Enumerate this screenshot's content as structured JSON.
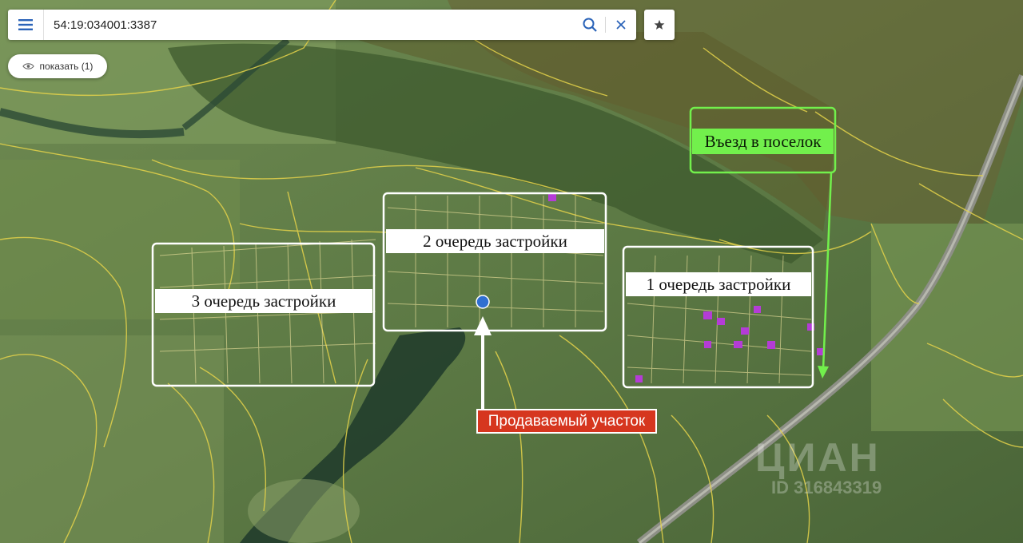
{
  "search": {
    "value": "54:19:034001:3387"
  },
  "show_button": {
    "label": "показать (1)"
  },
  "labels": {
    "zone_3": "3 очередь застройки",
    "zone_2": "2 очередь застройки",
    "zone_1": "1 очередь застройки",
    "entry": "Въезд в поселок",
    "plot": "Продаваемый участок"
  },
  "watermark": {
    "logo": "ЦИАН",
    "id": "ID 316843319"
  },
  "icons": [
    "menu-icon",
    "search-icon",
    "close-icon",
    "star-icon",
    "eye-icon"
  ],
  "colors": {
    "boundary": "#e4d24a",
    "callout_white": "#ffffff",
    "entry_green": "#72f04c",
    "plot_red": "#d6361f",
    "plot_marker": "#2f6fd1",
    "built_house": "#b43cd6"
  }
}
